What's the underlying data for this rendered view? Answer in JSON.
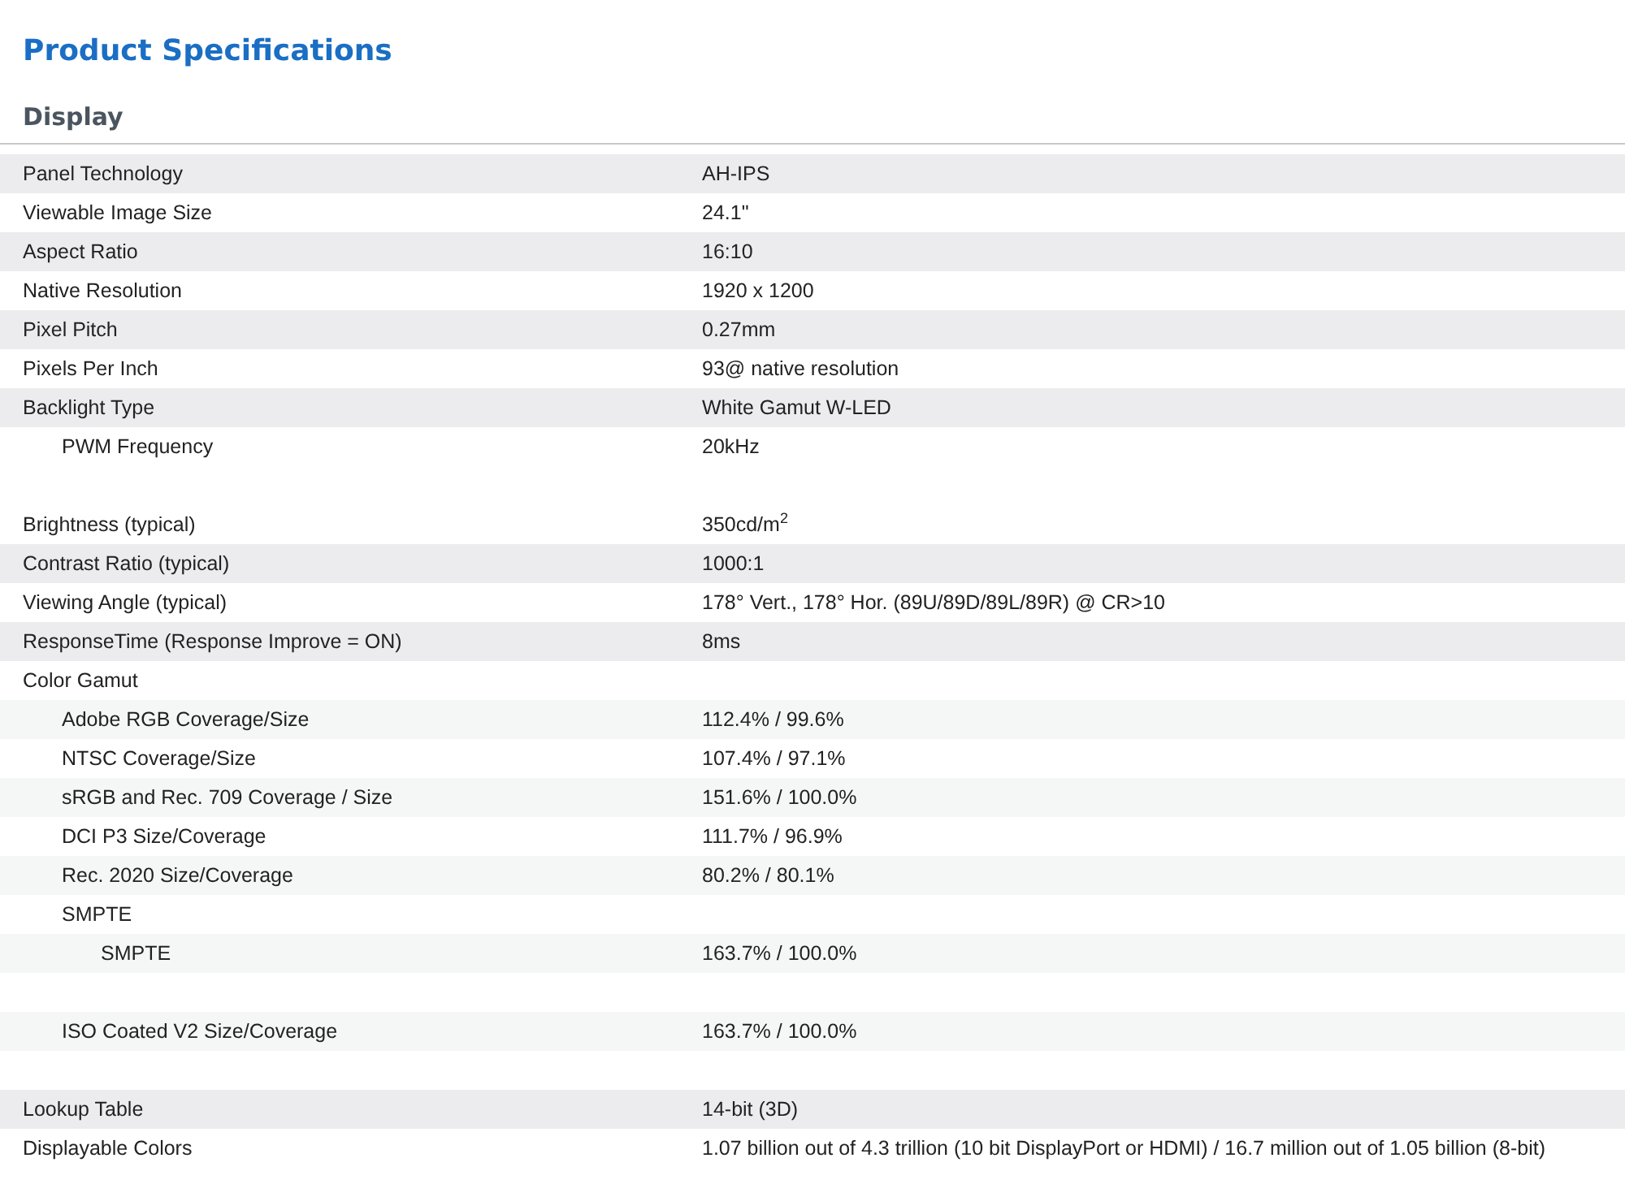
{
  "title": "Product Specifications",
  "section": {
    "title": "Display",
    "rows": [
      {
        "label": "Panel Technology",
        "value": "AH-IPS"
      },
      {
        "label": "Viewable Image Size",
        "value": "24.1\""
      },
      {
        "label": "Aspect Ratio",
        "value": "16:10"
      },
      {
        "label": "Native Resolution",
        "value": "1920 x 1200"
      },
      {
        "label": "Pixel Pitch",
        "value": "0.27mm"
      },
      {
        "label": "Pixels Per Inch",
        "value": "93@ native resolution"
      },
      {
        "label": "Backlight Type",
        "value": "White Gamut W-LED",
        "children": [
          {
            "label": "PWM Frequency",
            "value": "20kHz"
          }
        ]
      },
      {
        "label": "Brightness (typical)",
        "value": "350cd/m$^{2}$",
        "gap_before": true
      },
      {
        "label": "Contrast Ratio (typical)",
        "value": "1000:1"
      },
      {
        "label": "Viewing Angle (typical)",
        "value": "178° Vert., 178° Hor. (89U/89D/89L/89R) @ CR>10"
      },
      {
        "label": "ResponseTime (Response Improve = ON)",
        "value": "8ms"
      },
      {
        "label": "Color Gamut",
        "children": [
          {
            "label": "Adobe RGB Coverage/Size",
            "value": "112.4% / 99.6%"
          },
          {
            "label": "NTSC Coverage/Size",
            "value": "107.4% / 97.1%"
          },
          {
            "label": "sRGB and Rec. 709 Coverage / Size",
            "value": "151.6% / 100.0%"
          },
          {
            "label": "DCI P3 Size/Coverage",
            "value": "111.7% / 96.9%"
          },
          {
            "label": "Rec. 2020 Size/Coverage",
            "value": "80.2% / 80.1%"
          },
          {
            "label": "SMPTE",
            "children": [
              {
                "label": "SMPTE",
                "value": "163.7% / 100.0%"
              }
            ]
          },
          {
            "label": "ISO Coated V2 Size/Coverage",
            "value": "163.7% / 100.0%",
            "gap_before": true
          }
        ]
      },
      {
        "label": "Lookup Table",
        "value": "14-bit (3D)",
        "gap_before": true
      },
      {
        "label": "Displayable Colors",
        "value": "1.07 billion out of 4.3 trillion (10 bit DisplayPort or HDMI) / 16.7 million out of 1.05 billion (8-bit)"
      }
    ]
  }
}
